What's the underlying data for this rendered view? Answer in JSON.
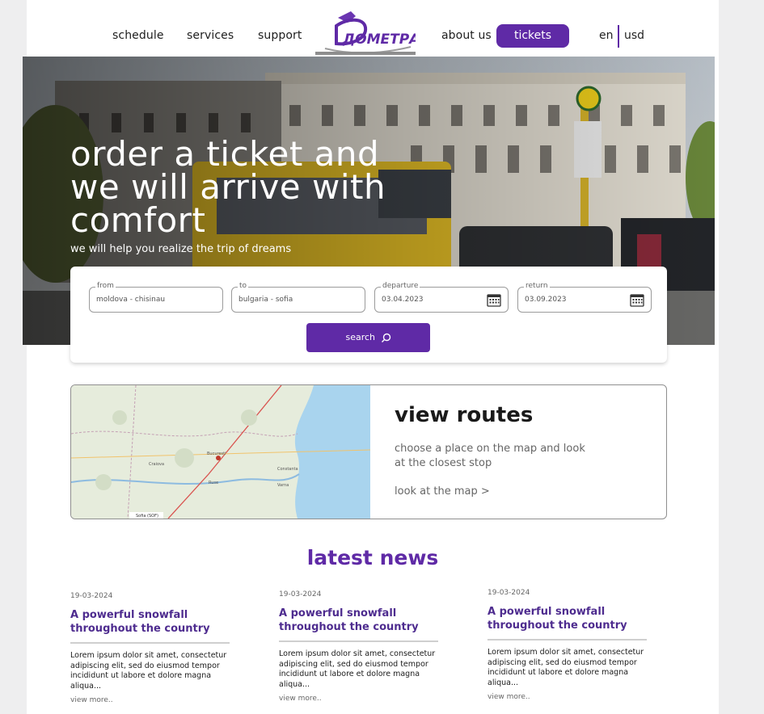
{
  "header": {
    "nav_left": [
      "schedule",
      "services",
      "support"
    ],
    "nav_right": [
      "about us"
    ],
    "logo_text": "ДОМЕТРА",
    "tickets_label": "tickets",
    "language": "en",
    "currency": "usd"
  },
  "hero": {
    "title": "order a ticket and we will arrive with comfort",
    "subtitle": "we will help you realize the trip of dreams"
  },
  "search": {
    "fields": [
      {
        "label": "from",
        "value": "moldova - chisinau"
      },
      {
        "label": "to",
        "value": "bulgaria - sofia"
      },
      {
        "label": "departure",
        "value": "03.04.2023"
      },
      {
        "label": "return",
        "value": "03.09.2023"
      }
    ],
    "button_label": "search"
  },
  "routes": {
    "title": "view routes",
    "description": "choose a place on the map and look at the closest stop",
    "link_label": "look at the map >",
    "map_labels": [
      "Bucuresti",
      "Craiova",
      "Sofia (SOF)",
      "Constanta",
      "Ruse",
      "Varna"
    ]
  },
  "news": {
    "heading": "latest news",
    "items": [
      {
        "date": "19-03-2024",
        "title": "A powerful snowfall throughout the country",
        "text": "Lorem ipsum dolor sit amet, consectetur adipiscing elit, sed do eiusmod tempor incididunt ut labore et dolore magna aliqua...",
        "more": "view more.."
      },
      {
        "date": "19-03-2024",
        "title": "A powerful snowfall throughout the country",
        "text": "Lorem ipsum dolor sit amet, consectetur adipiscing elit, sed do eiusmod tempor incididunt ut labore et dolore magna aliqua...",
        "more": "view more.."
      },
      {
        "date": "19-03-2024",
        "title": "A powerful snowfall throughout the country",
        "text": "Lorem ipsum dolor sit amet, consectetur adipiscing elit, sed do eiusmod tempor incididunt ut labore et dolore magna aliqua...",
        "more": "view more.."
      }
    ]
  },
  "colors": {
    "accent": "#5f2aa6",
    "news_title": "#4e2c8f",
    "background": "#eeeeef"
  },
  "icons": [
    "logo-icon",
    "calendar-icon",
    "search-icon",
    "map-pin-icon"
  ]
}
